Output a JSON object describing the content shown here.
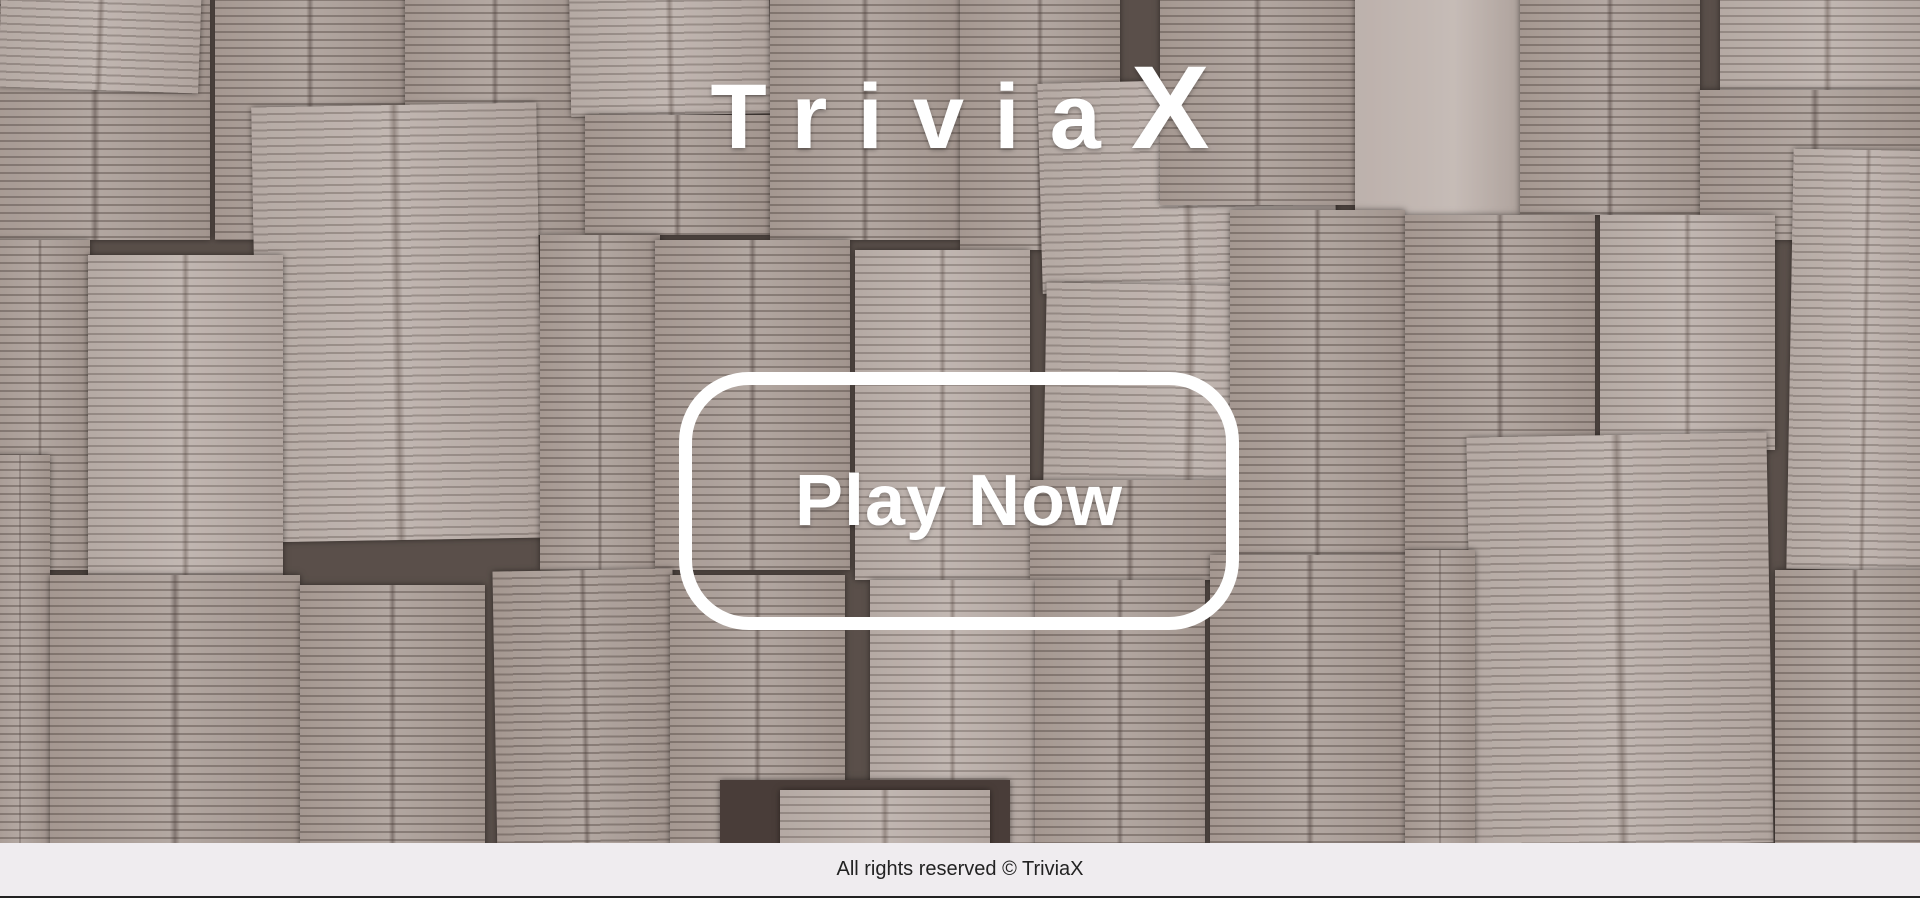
{
  "header": {
    "logo_word": "Trivia",
    "logo_x": "X"
  },
  "main": {
    "play_button_label": "Play Now"
  },
  "footer": {
    "text": "All rights reserved © TriviaX"
  },
  "colors": {
    "foreground": "#ffffff",
    "footer_background": "#efecef",
    "footer_text": "#222222",
    "background_tone": "#5e5550"
  }
}
